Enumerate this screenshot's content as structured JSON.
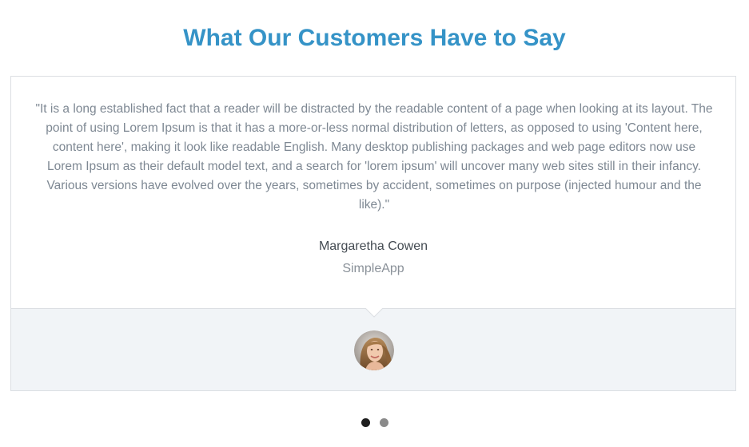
{
  "section": {
    "title": "What Our Customers Have to Say"
  },
  "testimonial": {
    "quote": "\"It is a long established fact that a reader will be distracted by the readable content of a page when looking at its layout. The point of using Lorem Ipsum is that it has a more-or-less normal distribution of letters, as opposed to using 'Content here, content here', making it look like readable English. Many desktop publishing packages and web page editors now use Lorem Ipsum as their default model text, and a search for 'lorem ipsum' will uncover many web sites still in their infancy. Various versions have evolved over the years, sometimes by accident, sometimes on purpose (injected humour and the like).\"",
    "author_name": "Margaretha Cowen",
    "author_company": "SimpleApp",
    "avatar_icon": "customer-avatar-photo"
  },
  "carousel": {
    "slide_count": 2,
    "active_index": 0
  },
  "colors": {
    "title": "#3593c7",
    "quote_text": "#7e8893",
    "author_name": "#444b52",
    "author_company": "#8a9199",
    "footer_bg": "#f1f4f7",
    "border": "#dcdfe3",
    "dot_active": "#1e1e1e",
    "dot_inactive": "#8a8a8a"
  }
}
